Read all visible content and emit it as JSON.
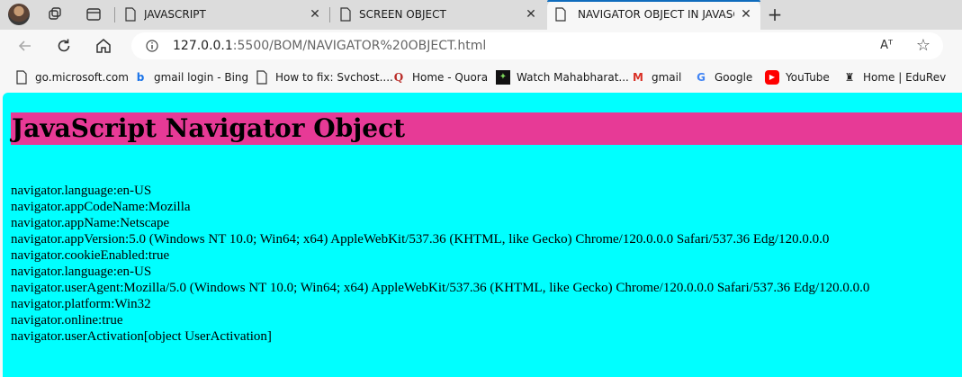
{
  "tabs": [
    {
      "title": "JAVASCRIPT",
      "close": "✕"
    },
    {
      "title": "SCREEN OBJECT",
      "close": "✕"
    },
    {
      "title": "NAVIGATOR OBJECT IN JAVASCRI",
      "close": "✕"
    }
  ],
  "new_tab": "+",
  "address": {
    "host": "127.0.0.1",
    "path": ":5500/BOM/NAVIGATOR%20OBJECT.html",
    "read_aloud": "Aᵀ",
    "favorite": "☆"
  },
  "bookmarks": [
    {
      "label": "go.microsoft.com",
      "icon": "doc-icon"
    },
    {
      "label": "gmail login - Bing",
      "icon": "bing-icon"
    },
    {
      "label": "How to fix: Svchost....",
      "icon": "doc-icon"
    },
    {
      "label": "Home - Quora",
      "icon": "quora-icon"
    },
    {
      "label": "Watch Mahabharat...",
      "icon": "mahabharat-icon"
    },
    {
      "label": "gmail",
      "icon": "gmail-icon"
    },
    {
      "label": "Google",
      "icon": "google-icon"
    },
    {
      "label": "YouTube",
      "icon": "youtube-icon"
    },
    {
      "label": "Home | EduRev",
      "icon": "edurev-icon"
    }
  ],
  "page": {
    "heading": "JavaScript Navigator Object",
    "lines": [
      "navigator.language:en-US",
      "navigator.appCodeName:Mozilla",
      "navigator.appName:Netscape",
      "navigator.appVersion:5.0 (Windows NT 10.0; Win64; x64) AppleWebKit/537.36 (KHTML, like Gecko) Chrome/120.0.0.0 Safari/537.36 Edg/120.0.0.0",
      "navigator.cookieEnabled:true",
      "navigator.language:en-US",
      "navigator.userAgent:Mozilla/5.0 (Windows NT 10.0; Win64; x64) AppleWebKit/537.36 (KHTML, like Gecko) Chrome/120.0.0.0 Safari/537.36 Edg/120.0.0.0",
      "navigator.platform:Win32",
      "navigator.online:true",
      "navigator.userActivation[object UserActivation]"
    ]
  },
  "colors": {
    "heading_bg": "#e73a96",
    "page_bg": "#00ffff",
    "accent": "#0f6cbd"
  }
}
